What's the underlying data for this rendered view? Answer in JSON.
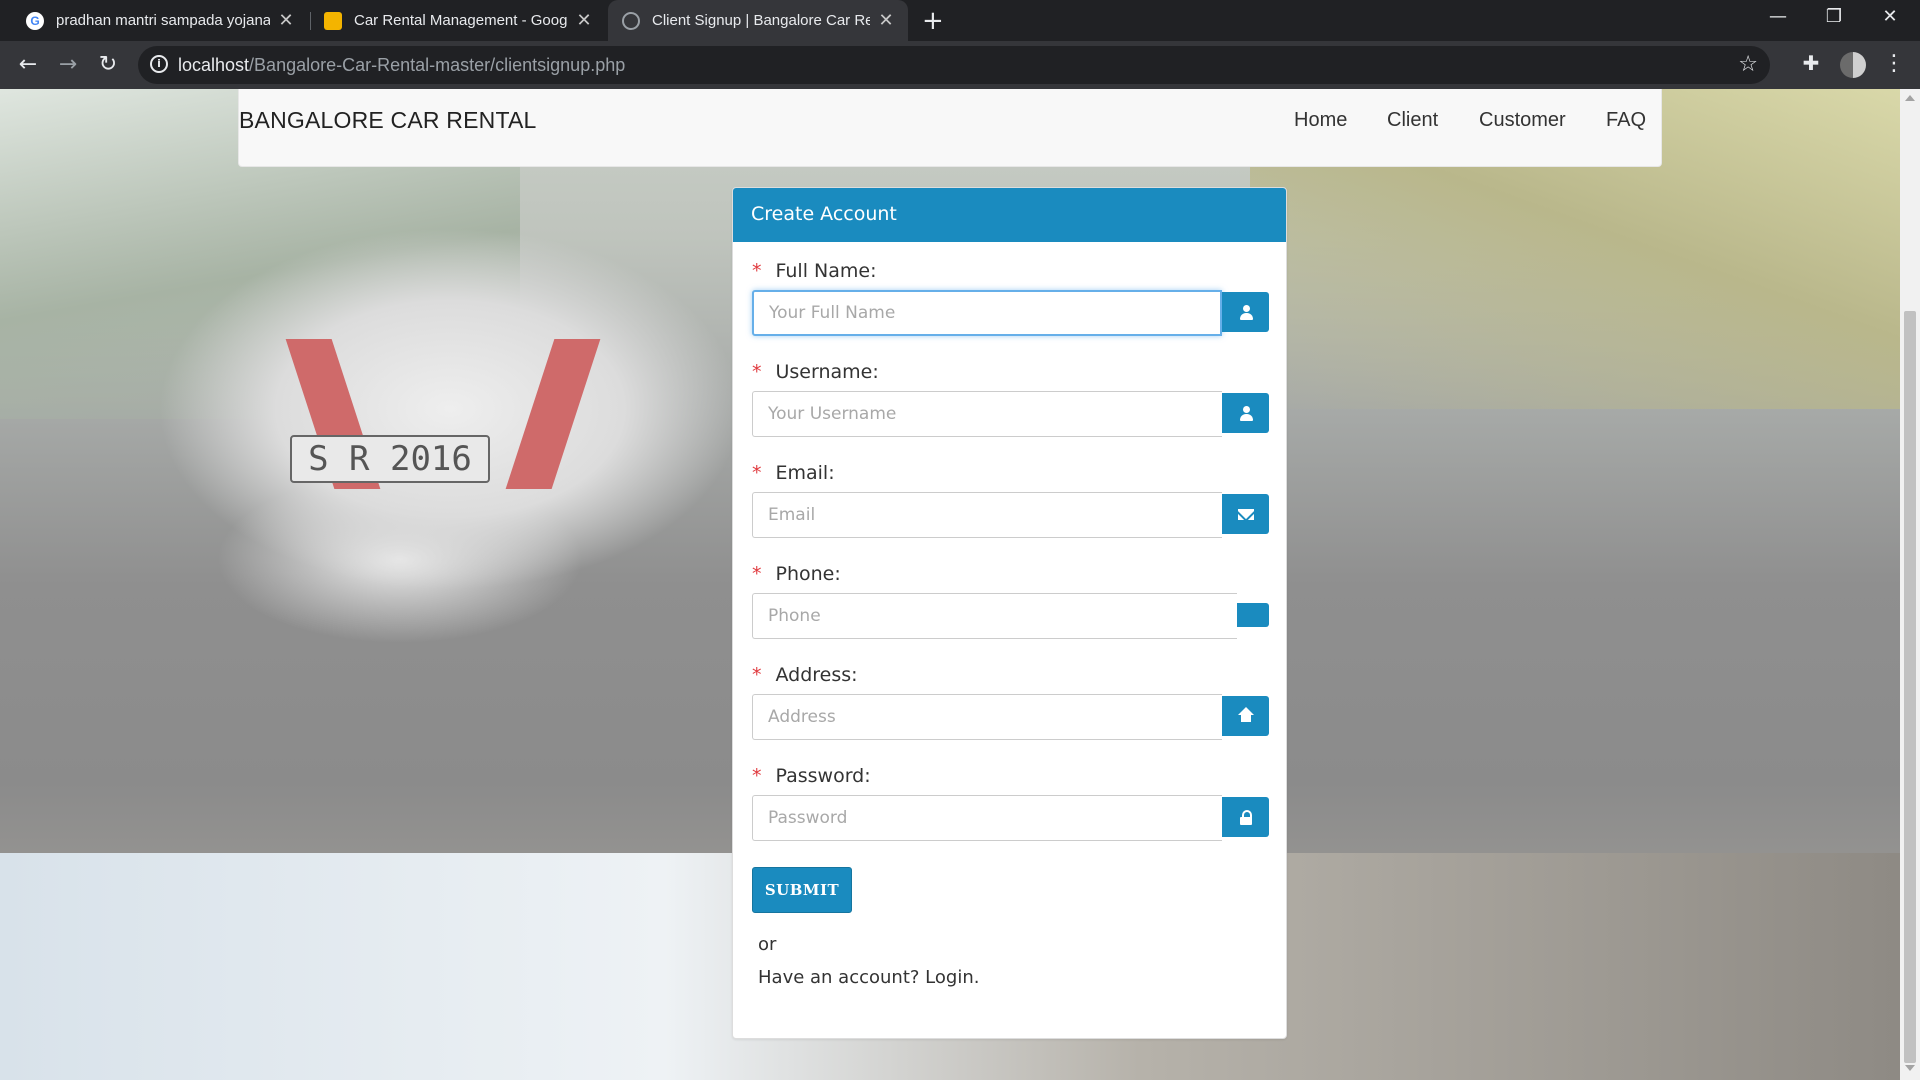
{
  "browser": {
    "tabs": [
      {
        "title": "pradhan mantri sampada yojana",
        "favicon": "google-icon",
        "active": false
      },
      {
        "title": "Car Rental Management - Google",
        "favicon": "slides-icon",
        "active": false
      },
      {
        "title": "Client Signup | Bangalore Car Rental",
        "favicon": "globe-icon",
        "active": true
      }
    ],
    "address": {
      "host": "localhost",
      "path": "/Bangalore-Car-Rental-master/clientsignup.php"
    }
  },
  "navbar": {
    "brand": "BANGALORE CAR RENTAL",
    "links": [
      "Home",
      "Client",
      "Customer",
      "FAQ"
    ]
  },
  "form": {
    "heading": "Create Account",
    "required_mark": "*",
    "fields": [
      {
        "label": "Full Name:",
        "placeholder": "Your Full Name",
        "icon": "user-icon",
        "focused": true
      },
      {
        "label": "Username:",
        "placeholder": "Your Username",
        "icon": "user-icon"
      },
      {
        "label": "Email:",
        "placeholder": "Email",
        "icon": "envelope-icon"
      },
      {
        "label": "Phone:",
        "placeholder": "Phone",
        "icon": ""
      },
      {
        "label": "Address:",
        "placeholder": "Address",
        "icon": "home-icon"
      },
      {
        "label": "Password:",
        "placeholder": "Password",
        "icon": "lock-icon"
      }
    ],
    "submit_label": "SUBMIT",
    "or_text": "or",
    "account_prompt": "Have an account?",
    "login_link": "Login."
  },
  "colors": {
    "accent": "#1a8bbf",
    "required": "#e0393e",
    "navbar_bg": "#f8f8f8"
  }
}
